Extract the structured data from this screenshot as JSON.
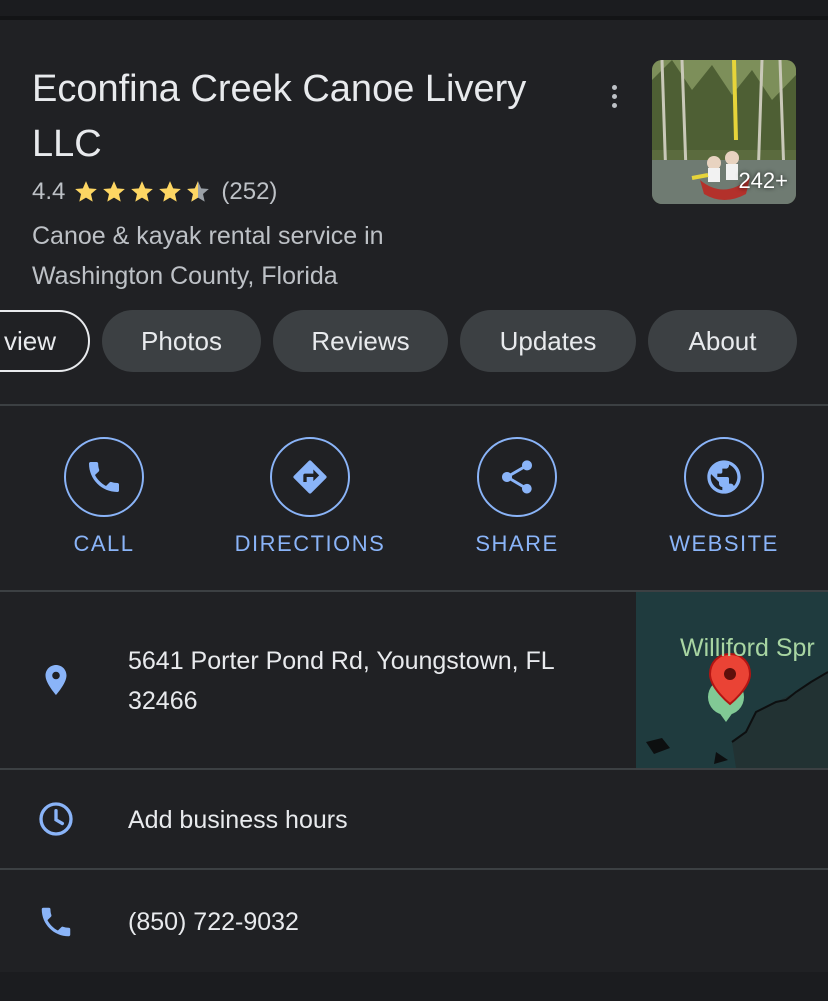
{
  "place": {
    "name": "Econfina Creek Canoe Livery LLC",
    "rating": "4.4",
    "review_count": "(252)",
    "rating_stars_value": 4.4,
    "category": "Canoe & kayak rental service in Washington County, Florida",
    "photo_count": "242+"
  },
  "tabs": [
    {
      "label": "view",
      "active": true
    },
    {
      "label": "Photos",
      "active": false
    },
    {
      "label": "Reviews",
      "active": false
    },
    {
      "label": "Updates",
      "active": false
    },
    {
      "label": "About",
      "active": false
    }
  ],
  "actions": [
    {
      "label": "CALL",
      "icon": "phone-icon"
    },
    {
      "label": "DIRECTIONS",
      "icon": "directions-icon"
    },
    {
      "label": "SHARE",
      "icon": "share-icon"
    },
    {
      "label": "WEBSITE",
      "icon": "globe-icon"
    }
  ],
  "details": {
    "address": "5641 Porter Pond Rd, Youngstown, FL 32466",
    "hours": "Add business hours",
    "phone": "(850) 722-9032"
  },
  "map": {
    "label": "Williford Spr"
  },
  "colors": {
    "background": "#202124",
    "accent": "#8ab4f8",
    "star": "#fdd663",
    "chip": "#3c4043",
    "pin": "#ea4335"
  }
}
